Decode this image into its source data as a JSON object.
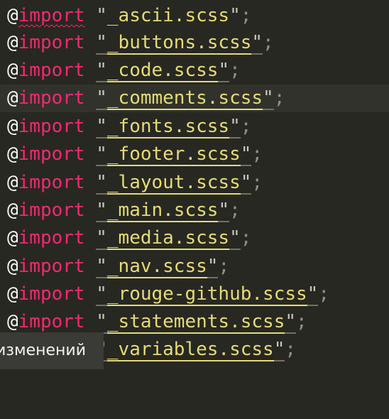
{
  "colors": {
    "background": "#272822",
    "current_line": "#31322c",
    "keyword": "#f92672",
    "string": "#e6db74",
    "punctuation": "#8f908a"
  },
  "lines": [
    {
      "at": "@",
      "kw": "import",
      "open": "\"",
      "file": "_ascii.scss",
      "close": "\"",
      "semi": ";"
    },
    {
      "at": "@",
      "kw": "import",
      "open": "\"",
      "file": "_buttons.scss",
      "close": "\"",
      "semi": ";"
    },
    {
      "at": "@",
      "kw": "import",
      "open": "\"",
      "file": "_code.scss",
      "close": "\"",
      "semi": ";"
    },
    {
      "at": "@",
      "kw": "import",
      "open": "\"",
      "file": "_comments.scss",
      "close": "\"",
      "semi": ";"
    },
    {
      "at": "@",
      "kw": "import",
      "open": "\"",
      "file": "_fonts.scss",
      "close": "\"",
      "semi": ";"
    },
    {
      "at": "@",
      "kw": "import",
      "open": "\"",
      "file": "_footer.scss",
      "close": "\"",
      "semi": ";"
    },
    {
      "at": "@",
      "kw": "import",
      "open": "\"",
      "file": "_layout.scss",
      "close": "\"",
      "semi": ";"
    },
    {
      "at": "@",
      "kw": "import",
      "open": "\"",
      "file": "_main.scss",
      "close": "\"",
      "semi": ";"
    },
    {
      "at": "@",
      "kw": "import",
      "open": "\"",
      "file": "_media.scss",
      "close": "\"",
      "semi": ";"
    },
    {
      "at": "@",
      "kw": "import",
      "open": "\"",
      "file": "_nav.scss",
      "close": "\"",
      "semi": ";"
    },
    {
      "at": "@",
      "kw": "import",
      "open": "\"",
      "file": "_rouge-github.scss",
      "close": "\"",
      "semi": ";"
    },
    {
      "at": "@",
      "kw": "import",
      "open": "\"",
      "file": "_statements.scss",
      "close": "\"",
      "semi": ";"
    },
    {
      "at": "@",
      "kw": "import",
      "open": "\"",
      "file": "_variables.scss",
      "close": "\"",
      "semi": ";"
    }
  ],
  "tooltip": {
    "text": "изменений"
  }
}
